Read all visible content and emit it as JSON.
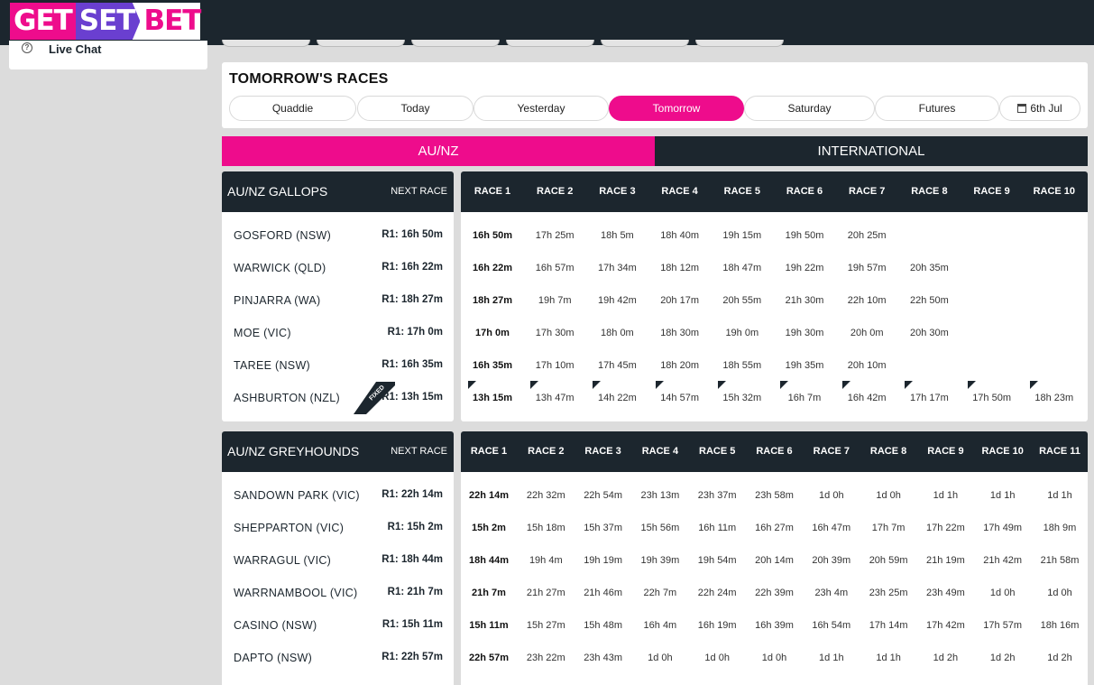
{
  "brand": {
    "logo_part1": "GET",
    "logo_part2": "SET",
    "logo_part3": "BET",
    "pink": "#ee0c8c",
    "dark": "#1c262e"
  },
  "sidebar": {
    "live_chat": "Live Chat",
    "icon": "chat-bubble-icon"
  },
  "races": {
    "title": "TOMORROW'S RACES",
    "tabs": [
      {
        "label": "Quaddie",
        "active": false
      },
      {
        "label": "Today",
        "active": false
      },
      {
        "label": "Yesterday",
        "active": false
      },
      {
        "label": "Tomorrow",
        "active": true
      },
      {
        "label": "Saturday",
        "active": false
      },
      {
        "label": "Futures",
        "active": false
      },
      {
        "label": "6th Jul",
        "active": false,
        "icon": "calendar-icon"
      }
    ],
    "regions": [
      {
        "label": "AU/NZ",
        "active": true
      },
      {
        "label": "INTERNATIONAL",
        "active": false
      }
    ]
  },
  "gallops": {
    "title": "AU/NZ GALLOPS",
    "next_label": "NEXT RACE",
    "race_headers": [
      "RACE 1",
      "RACE 2",
      "RACE 3",
      "RACE 4",
      "RACE 5",
      "RACE 6",
      "RACE 7",
      "RACE 8",
      "RACE 9",
      "RACE 10"
    ],
    "venues": [
      {
        "name": "GOSFORD (NSW)",
        "next": "R1: 16h 50m",
        "times": [
          "16h 50m",
          "17h 25m",
          "18h 5m",
          "18h 40m",
          "19h 15m",
          "19h 50m",
          "20h 25m"
        ]
      },
      {
        "name": "WARWICK (QLD)",
        "next": "R1: 16h 22m",
        "times": [
          "16h 22m",
          "16h 57m",
          "17h 34m",
          "18h 12m",
          "18h 47m",
          "19h 22m",
          "19h 57m",
          "20h 35m"
        ]
      },
      {
        "name": "PINJARRA (WA)",
        "next": "R1: 18h 27m",
        "times": [
          "18h 27m",
          "19h 7m",
          "19h 42m",
          "20h 17m",
          "20h 55m",
          "21h 30m",
          "22h 10m",
          "22h 50m"
        ]
      },
      {
        "name": "MOE (VIC)",
        "next": "R1: 17h 0m",
        "times": [
          "17h 0m",
          "17h 30m",
          "18h 0m",
          "18h 30m",
          "19h 0m",
          "19h 30m",
          "20h 0m",
          "20h 30m"
        ]
      },
      {
        "name": "TAREE (NSW)",
        "next": "R1: 16h 35m",
        "times": [
          "16h 35m",
          "17h 10m",
          "17h 45m",
          "18h 20m",
          "18h 55m",
          "19h 35m",
          "20h 10m"
        ]
      },
      {
        "name": "ASHBURTON (NZL)",
        "next": "R1: 13h 15m",
        "fixed": true,
        "fixed_label": "FIXED",
        "times": [
          "13h 15m",
          "13h 47m",
          "14h 22m",
          "14h 57m",
          "15h 32m",
          "16h 7m",
          "16h 42m",
          "17h 17m",
          "17h 50m",
          "18h 23m"
        ]
      }
    ]
  },
  "greyhounds": {
    "title": "AU/NZ GREYHOUNDS",
    "next_label": "NEXT RACE",
    "race_headers": [
      "RACE 1",
      "RACE 2",
      "RACE 3",
      "RACE 4",
      "RACE 5",
      "RACE 6",
      "RACE 7",
      "RACE 8",
      "RACE 9",
      "RACE 10",
      "RACE 11"
    ],
    "venues": [
      {
        "name": "SANDOWN PARK (VIC)",
        "next": "R1: 22h 14m",
        "times": [
          "22h 14m",
          "22h 32m",
          "22h 54m",
          "23h 13m",
          "23h 37m",
          "23h 58m",
          "1d 0h",
          "1d 0h",
          "1d 1h",
          "1d 1h",
          "1d 1h"
        ]
      },
      {
        "name": "SHEPPARTON (VIC)",
        "next": "R1: 15h 2m",
        "times": [
          "15h 2m",
          "15h 18m",
          "15h 37m",
          "15h 56m",
          "16h 11m",
          "16h 27m",
          "16h 47m",
          "17h 7m",
          "17h 22m",
          "17h 49m",
          "18h 9m"
        ]
      },
      {
        "name": "WARRAGUL (VIC)",
        "next": "R1: 18h 44m",
        "times": [
          "18h 44m",
          "19h 4m",
          "19h 19m",
          "19h 39m",
          "19h 54m",
          "20h 14m",
          "20h 39m",
          "20h 59m",
          "21h 19m",
          "21h 42m",
          "21h 58m"
        ]
      },
      {
        "name": "WARRNAMBOOL (VIC)",
        "next": "R1: 21h 7m",
        "times": [
          "21h 7m",
          "21h 27m",
          "21h 46m",
          "22h 7m",
          "22h 24m",
          "22h 39m",
          "23h 4m",
          "23h 25m",
          "23h 49m",
          "1d 0h",
          "1d 0h"
        ]
      },
      {
        "name": "CASINO (NSW)",
        "next": "R1: 15h 11m",
        "times": [
          "15h 11m",
          "15h 27m",
          "15h 48m",
          "16h 4m",
          "16h 19m",
          "16h 39m",
          "16h 54m",
          "17h 14m",
          "17h 42m",
          "17h 57m",
          "18h 16m"
        ]
      },
      {
        "name": "DAPTO (NSW)",
        "next": "R1: 22h 57m",
        "times": [
          "22h 57m",
          "23h 22m",
          "23h 43m",
          "1d 0h",
          "1d 0h",
          "1d 0h",
          "1d 1h",
          "1d 1h",
          "1d 2h",
          "1d 2h",
          "1d 2h"
        ]
      }
    ]
  }
}
